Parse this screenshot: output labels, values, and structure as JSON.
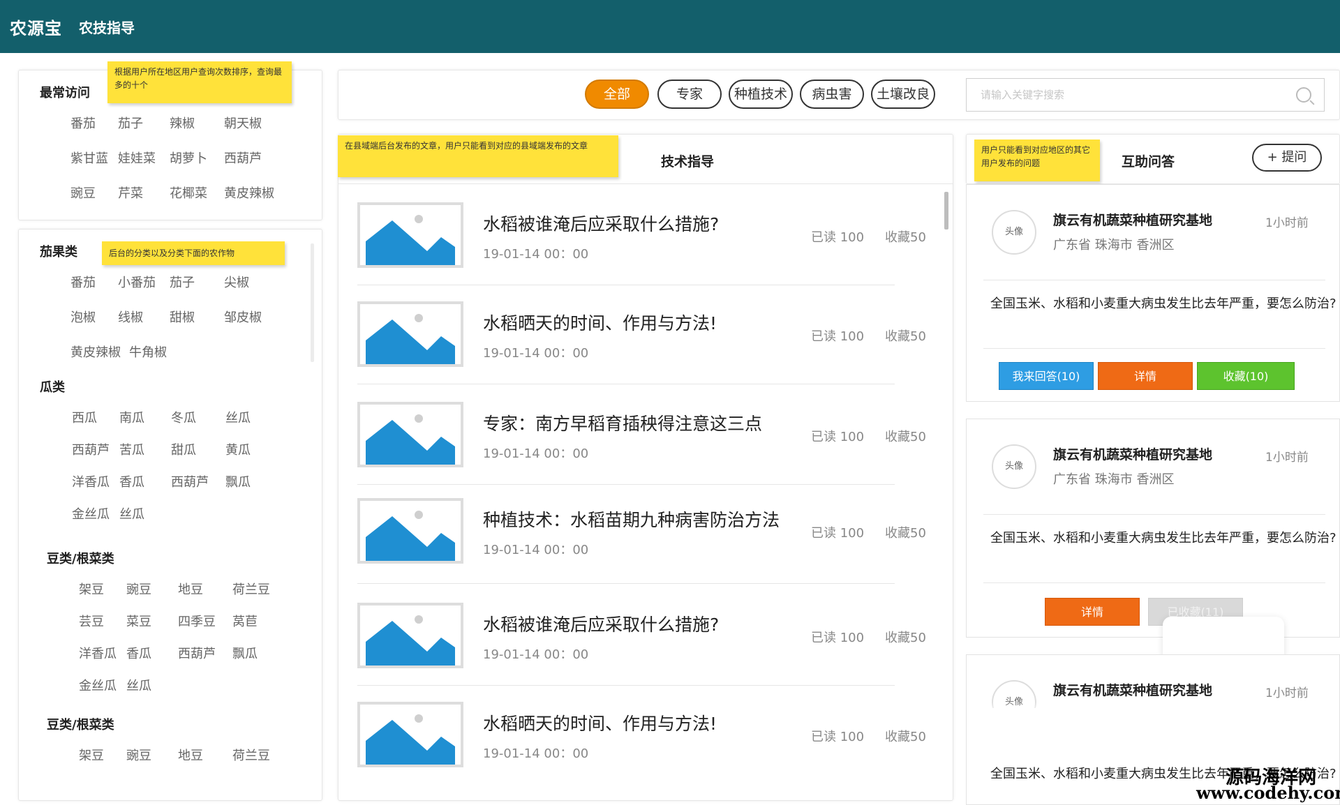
{
  "header": {
    "logo": "农源宝",
    "nav_label": "农技指导"
  },
  "notes": {
    "frequent": "根据用户所在地区用户查询次数排序，查询最多的十个",
    "category": "后台的分类以及分类下面的农作物",
    "articles": "在县域端后台发布的文章，用户只能看到对应的县域端发布的文章",
    "qa": "用户只能看到对应地区的其它用户发布的问题"
  },
  "sidebar": {
    "frequent": {
      "title": "最常访问",
      "items": [
        "番茄",
        "茄子",
        "辣椒",
        "朝天椒",
        "紫甘蓝",
        "娃娃菜",
        "胡萝卜",
        "西葫芦",
        "豌豆",
        "芹菜",
        "花椰菜",
        "黄皮辣椒"
      ]
    },
    "categories": [
      {
        "title": "茄果类",
        "items": [
          "番茄",
          "小番茄",
          "茄子",
          "尖椒",
          "泡椒",
          "线椒",
          "甜椒",
          "邹皮椒",
          "黄皮辣椒",
          "牛角椒"
        ]
      },
      {
        "title": "瓜类",
        "items": [
          "西瓜",
          "南瓜",
          "冬瓜",
          "丝瓜",
          "西葫芦",
          "苦瓜",
          "甜瓜",
          "黄瓜",
          "洋香瓜",
          "香瓜",
          "西葫芦",
          "飘瓜",
          "金丝瓜",
          "丝瓜"
        ]
      },
      {
        "title": "豆类/根菜类",
        "items": [
          "架豆",
          "豌豆",
          "地豆",
          "荷兰豆",
          "芸豆",
          "菜豆",
          "四季豆",
          "莴苣",
          "洋香瓜",
          "香瓜",
          "西葫芦",
          "飘瓜",
          "金丝瓜",
          "丝瓜"
        ]
      },
      {
        "title": "豆类/根菜类",
        "items": [
          "架豆",
          "豌豆",
          "地豆",
          "荷兰豆"
        ]
      }
    ]
  },
  "filters": {
    "pills": [
      "全部",
      "专家",
      "种植技术",
      "病虫害",
      "土壤改良"
    ],
    "active": "全部",
    "search_placeholder": "请输入关键字搜索"
  },
  "articles": {
    "title": "技术指导",
    "items": [
      {
        "title": "水稻被谁淹后应采取什么措施?",
        "time": "19-01-14 00：00",
        "read": "已读 100",
        "fav": "收藏50"
      },
      {
        "title": "水稻晒天的时间、作用与方法!",
        "time": "19-01-14 00：00",
        "read": "已读 100",
        "fav": "收藏50"
      },
      {
        "title": "专家：南方早稻育插秧得注意这三点",
        "time": "19-01-14 00：00",
        "read": "已读 100",
        "fav": "收藏50"
      },
      {
        "title": "种植技术：水稻苗期九种病害防治方法",
        "time": "19-01-14 00：00",
        "read": "已读 100",
        "fav": "收藏50"
      },
      {
        "title": "水稻被谁淹后应采取什么措施?",
        "time": "19-01-14 00：00",
        "read": "已读 100",
        "fav": "收藏50"
      },
      {
        "title": "水稻晒天的时间、作用与方法!",
        "time": "19-01-14 00：00",
        "read": "已读 100",
        "fav": "收藏50"
      }
    ]
  },
  "qa": {
    "title": "互助问答",
    "ask_label": "+ 提问",
    "items": [
      {
        "avatar": "头像",
        "org": "旗云有机蔬菜种植研究基地",
        "location": "广东省 珠海市 香洲区",
        "time": "1小时前",
        "question": "全国玉米、水稻和小麦重大病虫发生比去年严重，要怎么防治?",
        "btn_answer": "我来回答(10)",
        "btn_detail": "详情",
        "btn_fav": "收藏(10)"
      },
      {
        "avatar": "头像",
        "org": "旗云有机蔬菜种植研究基地",
        "location": "广东省 珠海市 香洲区",
        "time": "1小时前",
        "question": "全国玉米、水稻和小麦重大病虫发生比去年严重，要怎么防治?",
        "btn_detail": "详情",
        "btn_faved": "已收藏(11)"
      },
      {
        "avatar": "头像",
        "org": "旗云有机蔬菜种植研究基地",
        "time": "1小时前",
        "question": "全国玉米、水稻和小麦重大病虫发生比去年严重，要怎么防治?"
      }
    ]
  },
  "watermark": {
    "line1": "源码海洋网",
    "line2": "www.codehy.com"
  },
  "colors": {
    "header": "#135f6b",
    "accent": "#f08a00",
    "note": "#ffe23a",
    "blue": "#2e9de3",
    "orange": "#ef6a15",
    "green": "#5dc32e"
  }
}
